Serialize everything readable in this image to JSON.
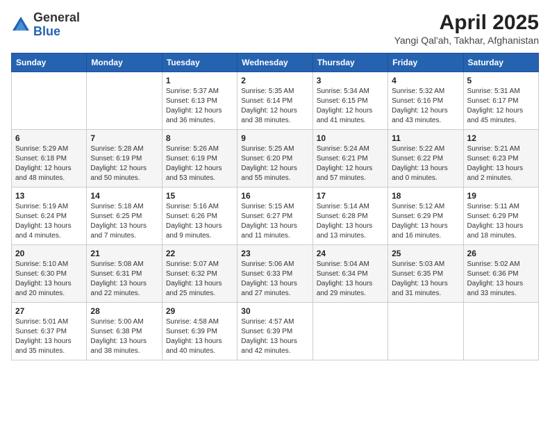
{
  "header": {
    "logo_line1": "General",
    "logo_line2": "Blue",
    "title": "April 2025",
    "subtitle": "Yangi Qal'ah, Takhar, Afghanistan"
  },
  "weekdays": [
    "Sunday",
    "Monday",
    "Tuesday",
    "Wednesday",
    "Thursday",
    "Friday",
    "Saturday"
  ],
  "weeks": [
    [
      {
        "day": "",
        "detail": ""
      },
      {
        "day": "",
        "detail": ""
      },
      {
        "day": "1",
        "detail": "Sunrise: 5:37 AM\nSunset: 6:13 PM\nDaylight: 12 hours and 36 minutes."
      },
      {
        "day": "2",
        "detail": "Sunrise: 5:35 AM\nSunset: 6:14 PM\nDaylight: 12 hours and 38 minutes."
      },
      {
        "day": "3",
        "detail": "Sunrise: 5:34 AM\nSunset: 6:15 PM\nDaylight: 12 hours and 41 minutes."
      },
      {
        "day": "4",
        "detail": "Sunrise: 5:32 AM\nSunset: 6:16 PM\nDaylight: 12 hours and 43 minutes."
      },
      {
        "day": "5",
        "detail": "Sunrise: 5:31 AM\nSunset: 6:17 PM\nDaylight: 12 hours and 45 minutes."
      }
    ],
    [
      {
        "day": "6",
        "detail": "Sunrise: 5:29 AM\nSunset: 6:18 PM\nDaylight: 12 hours and 48 minutes."
      },
      {
        "day": "7",
        "detail": "Sunrise: 5:28 AM\nSunset: 6:19 PM\nDaylight: 12 hours and 50 minutes."
      },
      {
        "day": "8",
        "detail": "Sunrise: 5:26 AM\nSunset: 6:19 PM\nDaylight: 12 hours and 53 minutes."
      },
      {
        "day": "9",
        "detail": "Sunrise: 5:25 AM\nSunset: 6:20 PM\nDaylight: 12 hours and 55 minutes."
      },
      {
        "day": "10",
        "detail": "Sunrise: 5:24 AM\nSunset: 6:21 PM\nDaylight: 12 hours and 57 minutes."
      },
      {
        "day": "11",
        "detail": "Sunrise: 5:22 AM\nSunset: 6:22 PM\nDaylight: 13 hours and 0 minutes."
      },
      {
        "day": "12",
        "detail": "Sunrise: 5:21 AM\nSunset: 6:23 PM\nDaylight: 13 hours and 2 minutes."
      }
    ],
    [
      {
        "day": "13",
        "detail": "Sunrise: 5:19 AM\nSunset: 6:24 PM\nDaylight: 13 hours and 4 minutes."
      },
      {
        "day": "14",
        "detail": "Sunrise: 5:18 AM\nSunset: 6:25 PM\nDaylight: 13 hours and 7 minutes."
      },
      {
        "day": "15",
        "detail": "Sunrise: 5:16 AM\nSunset: 6:26 PM\nDaylight: 13 hours and 9 minutes."
      },
      {
        "day": "16",
        "detail": "Sunrise: 5:15 AM\nSunset: 6:27 PM\nDaylight: 13 hours and 11 minutes."
      },
      {
        "day": "17",
        "detail": "Sunrise: 5:14 AM\nSunset: 6:28 PM\nDaylight: 13 hours and 13 minutes."
      },
      {
        "day": "18",
        "detail": "Sunrise: 5:12 AM\nSunset: 6:29 PM\nDaylight: 13 hours and 16 minutes."
      },
      {
        "day": "19",
        "detail": "Sunrise: 5:11 AM\nSunset: 6:29 PM\nDaylight: 13 hours and 18 minutes."
      }
    ],
    [
      {
        "day": "20",
        "detail": "Sunrise: 5:10 AM\nSunset: 6:30 PM\nDaylight: 13 hours and 20 minutes."
      },
      {
        "day": "21",
        "detail": "Sunrise: 5:08 AM\nSunset: 6:31 PM\nDaylight: 13 hours and 22 minutes."
      },
      {
        "day": "22",
        "detail": "Sunrise: 5:07 AM\nSunset: 6:32 PM\nDaylight: 13 hours and 25 minutes."
      },
      {
        "day": "23",
        "detail": "Sunrise: 5:06 AM\nSunset: 6:33 PM\nDaylight: 13 hours and 27 minutes."
      },
      {
        "day": "24",
        "detail": "Sunrise: 5:04 AM\nSunset: 6:34 PM\nDaylight: 13 hours and 29 minutes."
      },
      {
        "day": "25",
        "detail": "Sunrise: 5:03 AM\nSunset: 6:35 PM\nDaylight: 13 hours and 31 minutes."
      },
      {
        "day": "26",
        "detail": "Sunrise: 5:02 AM\nSunset: 6:36 PM\nDaylight: 13 hours and 33 minutes."
      }
    ],
    [
      {
        "day": "27",
        "detail": "Sunrise: 5:01 AM\nSunset: 6:37 PM\nDaylight: 13 hours and 35 minutes."
      },
      {
        "day": "28",
        "detail": "Sunrise: 5:00 AM\nSunset: 6:38 PM\nDaylight: 13 hours and 38 minutes."
      },
      {
        "day": "29",
        "detail": "Sunrise: 4:58 AM\nSunset: 6:39 PM\nDaylight: 13 hours and 40 minutes."
      },
      {
        "day": "30",
        "detail": "Sunrise: 4:57 AM\nSunset: 6:39 PM\nDaylight: 13 hours and 42 minutes."
      },
      {
        "day": "",
        "detail": ""
      },
      {
        "day": "",
        "detail": ""
      },
      {
        "day": "",
        "detail": ""
      }
    ]
  ]
}
